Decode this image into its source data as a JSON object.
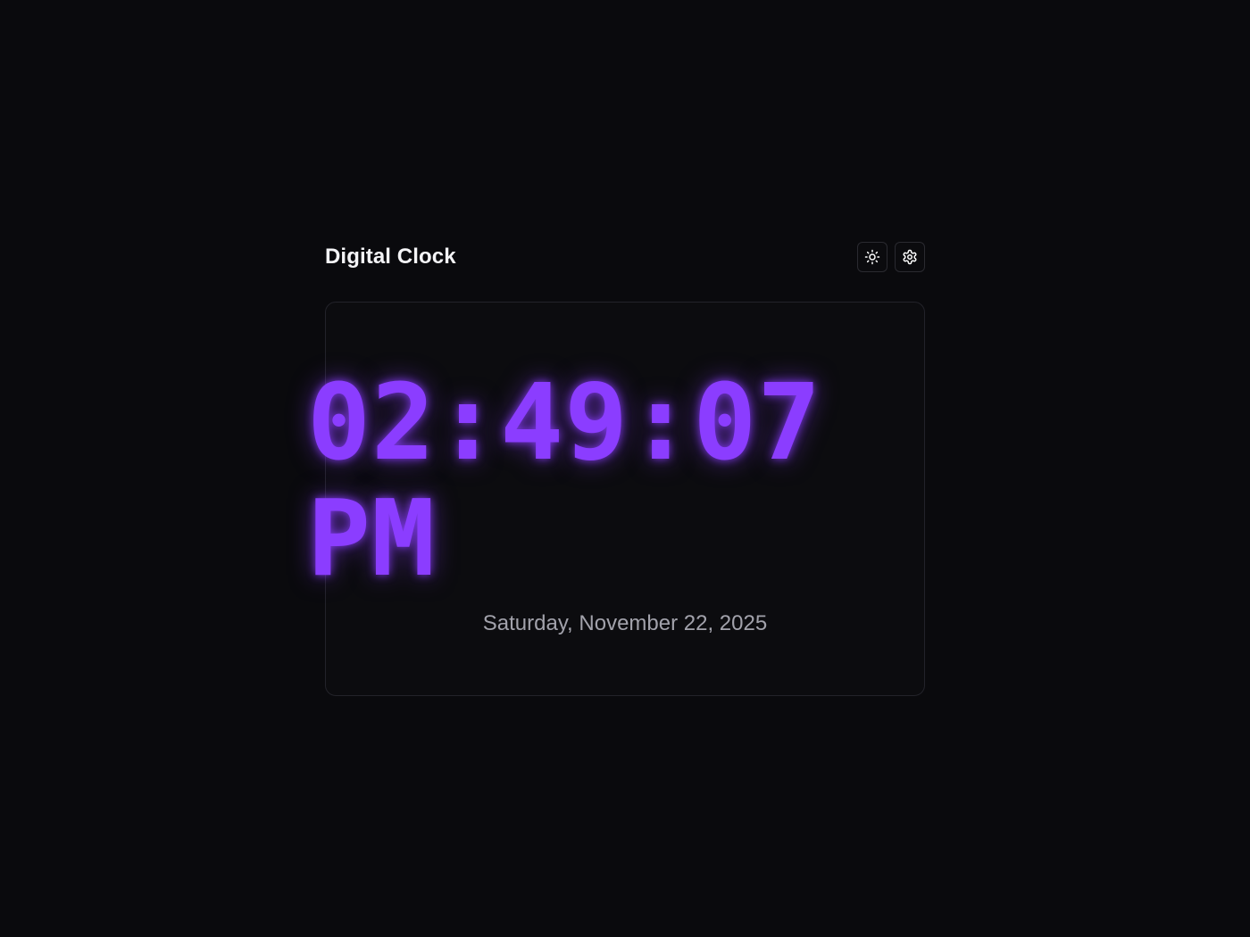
{
  "header": {
    "title": "Digital Clock",
    "theme_button": {
      "icon": "sun-icon"
    },
    "settings_button": {
      "icon": "gear-icon"
    }
  },
  "clock": {
    "time": "02:49:07",
    "meridiem": "PM",
    "date": "Saturday, November 22, 2025"
  },
  "colors": {
    "background": "#0a0a0d",
    "card": "#0c0c0f",
    "accent": "#8b3dff",
    "date_text": "#a2a2ab"
  }
}
